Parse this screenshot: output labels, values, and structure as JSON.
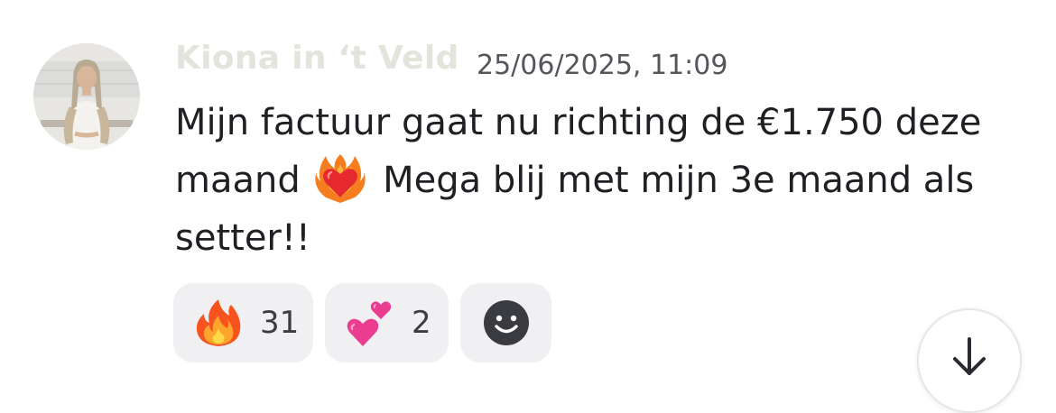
{
  "message": {
    "author": "Kiona in ‘t Veld",
    "timestamp": "25/06/2025, 11:09",
    "text_part1": "Mijn factuur gaat nu richting de €1.750 deze maand",
    "inline_emoji": "heart-on-fire",
    "text_part2": "Mega blij met mijn 3e maand als setter!!"
  },
  "reactions": [
    {
      "emoji": "fire",
      "count": "31"
    },
    {
      "emoji": "two-hearts",
      "count": "2"
    }
  ],
  "add_reaction_icon": "smiley-icon",
  "scroll_down_icon": "arrow-down-icon",
  "colors": {
    "author": "#e4e3dc",
    "timestamp": "#55565c",
    "body_text": "#1f2024",
    "reaction_bg": "#f0f0f2"
  }
}
